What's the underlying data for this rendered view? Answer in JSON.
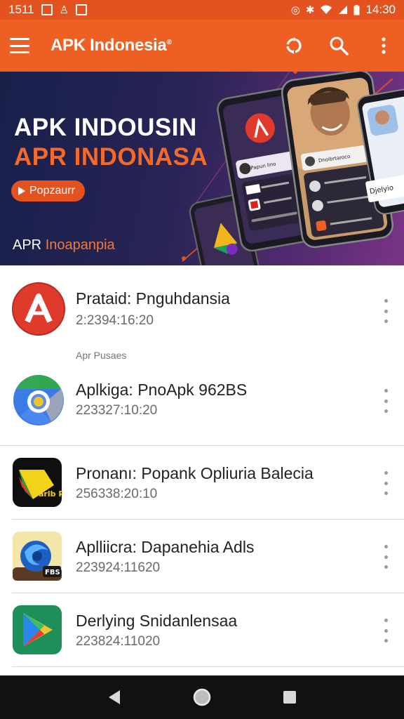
{
  "status_bar": {
    "time_left": "1511",
    "time_right": "14:30",
    "icons": [
      "image-icon",
      "person-icon",
      "square-icon",
      "alarm-icon",
      "bluetooth-icon",
      "wifi-icon",
      "signal-icon",
      "battery-icon"
    ]
  },
  "app_bar": {
    "title": "APK Indonesia",
    "title_mark": "®",
    "actions": [
      "sync-icon",
      "search-icon",
      "more-vert-icon"
    ]
  },
  "banner": {
    "headline": "APK INDOUSIN",
    "subheadline": "APR INDONASA",
    "button_label": "Popzaurr",
    "footer_prefix": "APR ",
    "footer_accent": "Inoapanpia",
    "phone_texts": [
      "Papun lino",
      "Dnoibrtaroco",
      "Djelyio"
    ]
  },
  "apps": [
    {
      "title": "Prataid: Pnguhdansia",
      "subtitle": "2:2394:16:20",
      "icon": "red-a-logo-icon"
    },
    {
      "title": "Aplkiga: PnoApk 962BS",
      "subtitle": "223327:10:20",
      "icon": "chrome-logo-icon"
    },
    {
      "title": "Pronanı: Popank Opliuria Balecia",
      "subtitle": "256338:20:10",
      "icon": "play-arrow-logo-icon",
      "icon_text": "arlb PFY"
    },
    {
      "title": "Aplliicra: Dapanehia Adls",
      "subtitle": "223924:11620",
      "icon": "blue-swirl-logo-icon",
      "icon_text": "FBS"
    },
    {
      "title": "Derlying Snidanlensaa",
      "subtitle": "223824:11020",
      "icon": "play-store-logo-icon"
    }
  ],
  "section_label": "Apr Pusaes",
  "colors": {
    "status_bar": "#e4521f",
    "app_bar": "#ed5f22",
    "accent": "#f36a2a",
    "nav_bar": "#111111"
  }
}
